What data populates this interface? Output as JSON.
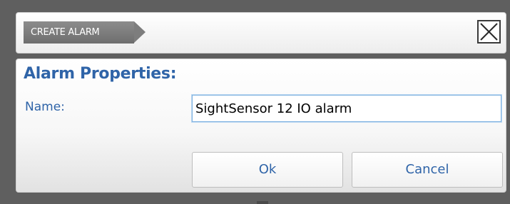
{
  "header": {
    "breadcrumb": "CREATE ALARM",
    "close_icon": "close-x-icon"
  },
  "form": {
    "section_title": "Alarm Properties:",
    "name_label": "Name:",
    "name_value": "SightSensor 12 IO alarm"
  },
  "buttons": {
    "ok_label": "Ok",
    "cancel_label": "Cancel"
  },
  "colors": {
    "accent_text": "#2f64a8",
    "backdrop": "#5f5f5f",
    "input_focus_border": "#7fb2e0"
  }
}
